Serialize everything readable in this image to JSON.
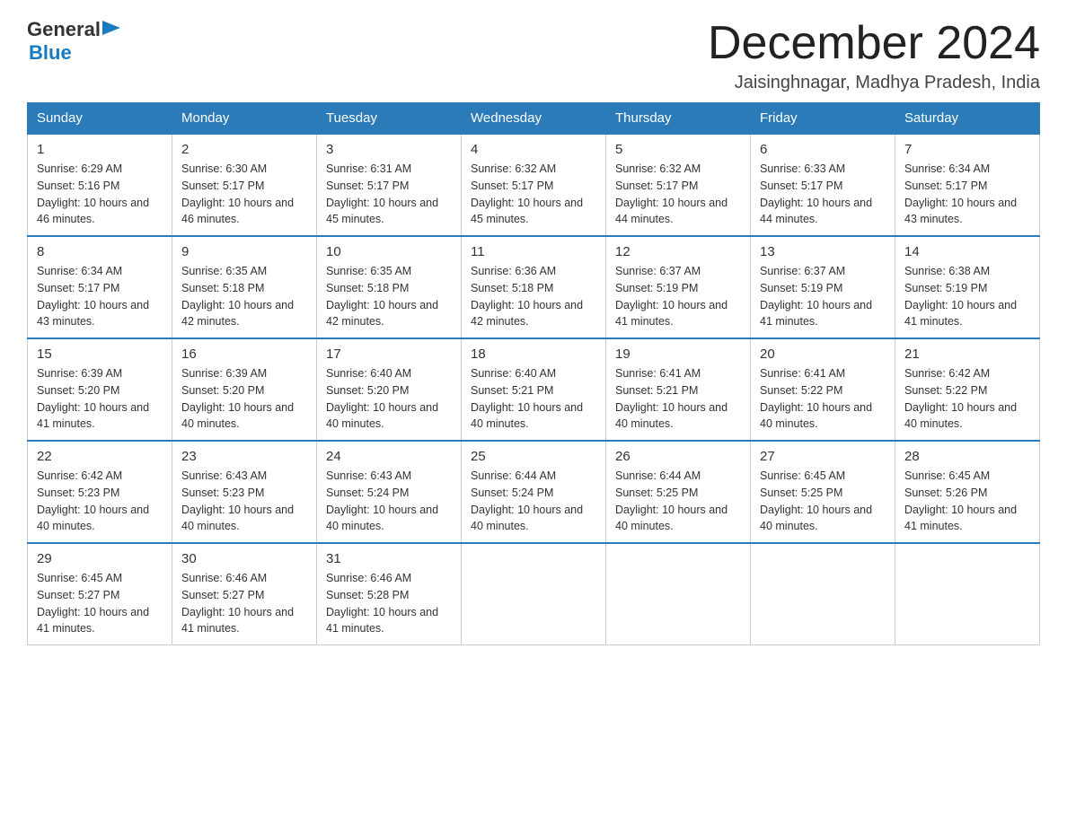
{
  "header": {
    "logo": {
      "general": "General",
      "blue": "Blue",
      "line2": "Blue"
    },
    "month_year": "December 2024",
    "location": "Jaisinghnagar, Madhya Pradesh, India"
  },
  "days_of_week": [
    "Sunday",
    "Monday",
    "Tuesday",
    "Wednesday",
    "Thursday",
    "Friday",
    "Saturday"
  ],
  "weeks": [
    [
      {
        "day": "1",
        "sunrise": "6:29 AM",
        "sunset": "5:16 PM",
        "daylight": "10 hours and 46 minutes."
      },
      {
        "day": "2",
        "sunrise": "6:30 AM",
        "sunset": "5:17 PM",
        "daylight": "10 hours and 46 minutes."
      },
      {
        "day": "3",
        "sunrise": "6:31 AM",
        "sunset": "5:17 PM",
        "daylight": "10 hours and 45 minutes."
      },
      {
        "day": "4",
        "sunrise": "6:32 AM",
        "sunset": "5:17 PM",
        "daylight": "10 hours and 45 minutes."
      },
      {
        "day": "5",
        "sunrise": "6:32 AM",
        "sunset": "5:17 PM",
        "daylight": "10 hours and 44 minutes."
      },
      {
        "day": "6",
        "sunrise": "6:33 AM",
        "sunset": "5:17 PM",
        "daylight": "10 hours and 44 minutes."
      },
      {
        "day": "7",
        "sunrise": "6:34 AM",
        "sunset": "5:17 PM",
        "daylight": "10 hours and 43 minutes."
      }
    ],
    [
      {
        "day": "8",
        "sunrise": "6:34 AM",
        "sunset": "5:17 PM",
        "daylight": "10 hours and 43 minutes."
      },
      {
        "day": "9",
        "sunrise": "6:35 AM",
        "sunset": "5:18 PM",
        "daylight": "10 hours and 42 minutes."
      },
      {
        "day": "10",
        "sunrise": "6:35 AM",
        "sunset": "5:18 PM",
        "daylight": "10 hours and 42 minutes."
      },
      {
        "day": "11",
        "sunrise": "6:36 AM",
        "sunset": "5:18 PM",
        "daylight": "10 hours and 42 minutes."
      },
      {
        "day": "12",
        "sunrise": "6:37 AM",
        "sunset": "5:19 PM",
        "daylight": "10 hours and 41 minutes."
      },
      {
        "day": "13",
        "sunrise": "6:37 AM",
        "sunset": "5:19 PM",
        "daylight": "10 hours and 41 minutes."
      },
      {
        "day": "14",
        "sunrise": "6:38 AM",
        "sunset": "5:19 PM",
        "daylight": "10 hours and 41 minutes."
      }
    ],
    [
      {
        "day": "15",
        "sunrise": "6:39 AM",
        "sunset": "5:20 PM",
        "daylight": "10 hours and 41 minutes."
      },
      {
        "day": "16",
        "sunrise": "6:39 AM",
        "sunset": "5:20 PM",
        "daylight": "10 hours and 40 minutes."
      },
      {
        "day": "17",
        "sunrise": "6:40 AM",
        "sunset": "5:20 PM",
        "daylight": "10 hours and 40 minutes."
      },
      {
        "day": "18",
        "sunrise": "6:40 AM",
        "sunset": "5:21 PM",
        "daylight": "10 hours and 40 minutes."
      },
      {
        "day": "19",
        "sunrise": "6:41 AM",
        "sunset": "5:21 PM",
        "daylight": "10 hours and 40 minutes."
      },
      {
        "day": "20",
        "sunrise": "6:41 AM",
        "sunset": "5:22 PM",
        "daylight": "10 hours and 40 minutes."
      },
      {
        "day": "21",
        "sunrise": "6:42 AM",
        "sunset": "5:22 PM",
        "daylight": "10 hours and 40 minutes."
      }
    ],
    [
      {
        "day": "22",
        "sunrise": "6:42 AM",
        "sunset": "5:23 PM",
        "daylight": "10 hours and 40 minutes."
      },
      {
        "day": "23",
        "sunrise": "6:43 AM",
        "sunset": "5:23 PM",
        "daylight": "10 hours and 40 minutes."
      },
      {
        "day": "24",
        "sunrise": "6:43 AM",
        "sunset": "5:24 PM",
        "daylight": "10 hours and 40 minutes."
      },
      {
        "day": "25",
        "sunrise": "6:44 AM",
        "sunset": "5:24 PM",
        "daylight": "10 hours and 40 minutes."
      },
      {
        "day": "26",
        "sunrise": "6:44 AM",
        "sunset": "5:25 PM",
        "daylight": "10 hours and 40 minutes."
      },
      {
        "day": "27",
        "sunrise": "6:45 AM",
        "sunset": "5:25 PM",
        "daylight": "10 hours and 40 minutes."
      },
      {
        "day": "28",
        "sunrise": "6:45 AM",
        "sunset": "5:26 PM",
        "daylight": "10 hours and 41 minutes."
      }
    ],
    [
      {
        "day": "29",
        "sunrise": "6:45 AM",
        "sunset": "5:27 PM",
        "daylight": "10 hours and 41 minutes."
      },
      {
        "day": "30",
        "sunrise": "6:46 AM",
        "sunset": "5:27 PM",
        "daylight": "10 hours and 41 minutes."
      },
      {
        "day": "31",
        "sunrise": "6:46 AM",
        "sunset": "5:28 PM",
        "daylight": "10 hours and 41 minutes."
      },
      null,
      null,
      null,
      null
    ]
  ]
}
